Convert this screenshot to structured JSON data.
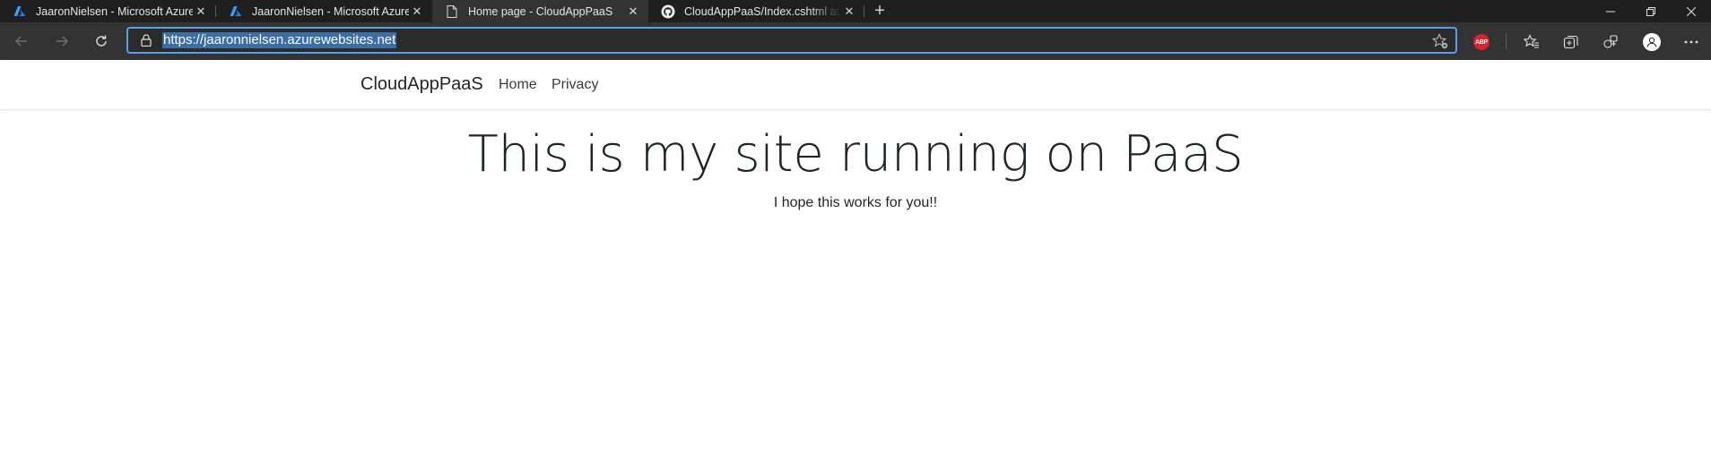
{
  "browser": {
    "tabs": [
      {
        "title": "JaaronNielsen - Microsoft Azure",
        "icon": "azure-icon",
        "active": false
      },
      {
        "title": "JaaronNielsen - Microsoft Azure",
        "icon": "azure-icon",
        "active": false
      },
      {
        "title": "Home page - CloudAppPaaS",
        "icon": "page-icon",
        "active": true
      },
      {
        "title": "CloudAppPaaS/Index.cshtml at m",
        "icon": "github-icon",
        "active": false
      }
    ],
    "new_tab_symbol": "+",
    "window_controls": {
      "minimize": "—",
      "restore": "❐",
      "close": "✕"
    },
    "address": {
      "url": "https://jaaronnielsen.azurewebsites.net"
    },
    "extensions": {
      "adblock_label": "ABP"
    },
    "colors": {
      "accent": "#5aa0e6",
      "selection": "#3c6ea6",
      "tabstrip": "#1f1f1f",
      "toolbar": "#333333"
    }
  },
  "site": {
    "brand": "CloudAppPaaS",
    "nav": [
      {
        "label": "Home"
      },
      {
        "label": "Privacy"
      }
    ],
    "heading": "This is my site running on PaaS",
    "subheading": "I hope this works for you!!"
  }
}
